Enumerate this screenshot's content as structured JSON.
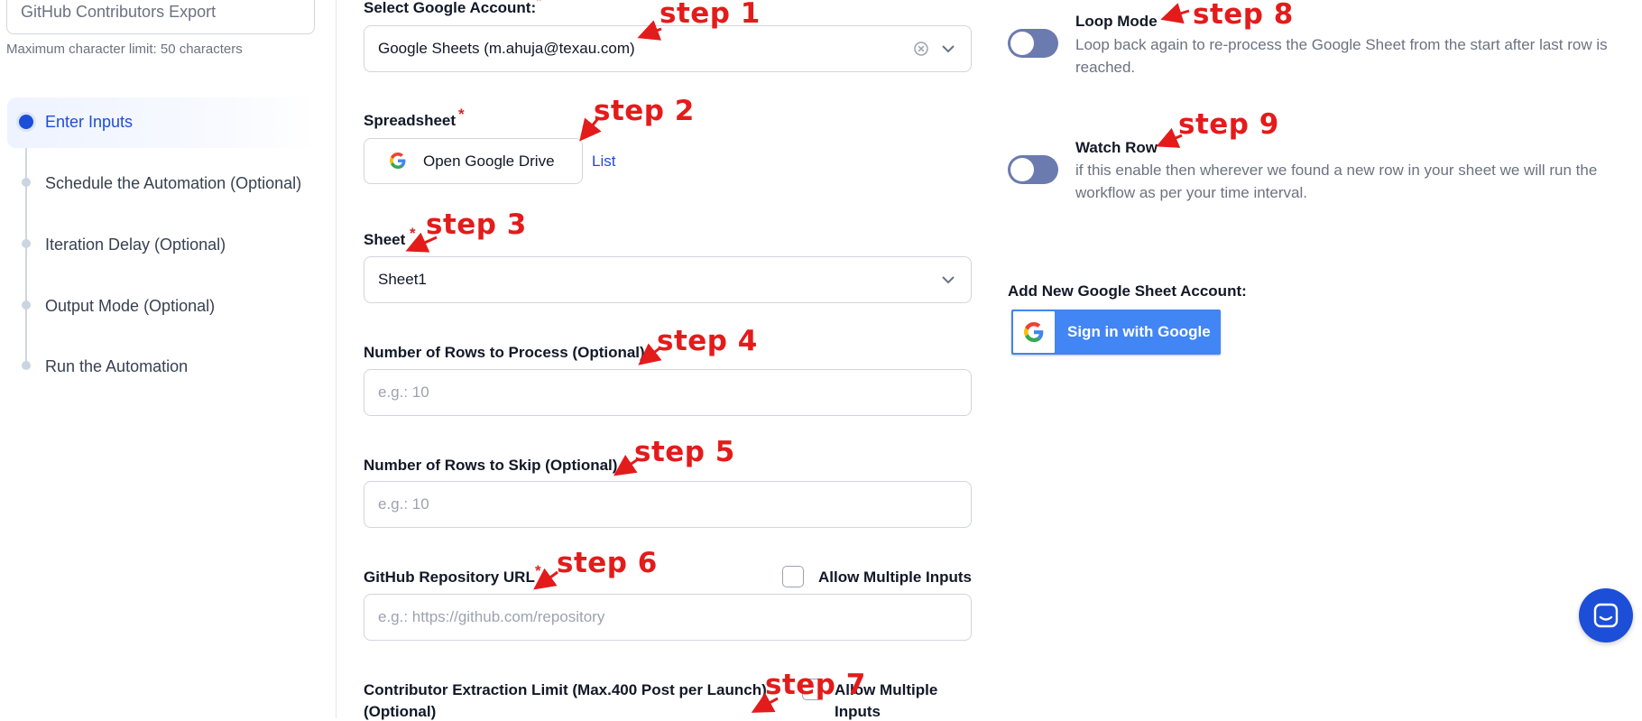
{
  "sidebar": {
    "automation_name": "GitHub Contributors Export",
    "char_limit_hint": "Maximum character limit: 50 characters",
    "steps": [
      {
        "label": "Enter Inputs",
        "active": true
      },
      {
        "label": "Schedule the Automation (Optional)",
        "active": false
      },
      {
        "label": "Iteration Delay (Optional)",
        "active": false
      },
      {
        "label": "Output Mode (Optional)",
        "active": false
      },
      {
        "label": "Run the Automation",
        "active": false
      }
    ]
  },
  "form": {
    "google_account": {
      "label": "Select Google Account:",
      "value": "Google Sheets (m.ahuja@texau.com)"
    },
    "spreadsheet": {
      "label": "Spreadsheet",
      "button_label": "Open Google Drive",
      "link_label": "List"
    },
    "sheet": {
      "label": "Sheet",
      "value": "Sheet1"
    },
    "rows_to_process": {
      "label": "Number of Rows to Process (Optional)",
      "placeholder": "e.g.: 10"
    },
    "rows_to_skip": {
      "label": "Number of Rows to Skip (Optional)",
      "placeholder": "e.g.: 10"
    },
    "repo_url": {
      "label": "GitHub Repository URL",
      "placeholder": "e.g.: https://github.com/repository",
      "multi_label": "Allow Multiple Inputs"
    },
    "contributor_limit": {
      "label_line1": "Contributor Extraction Limit (Max.400 Post per Launch)",
      "label_line2": "(Optional)",
      "multi_line1": "Allow Multiple",
      "multi_line2": "Inputs"
    }
  },
  "right": {
    "loop_mode": {
      "title": "Loop Mode",
      "desc": "Loop back again to re-process the Google Sheet from the start after last row is reached."
    },
    "watch_row": {
      "title": "Watch Row",
      "desc": "if this enable then wherever we found a new row in your sheet we will run the workflow as per your time interval."
    },
    "add_account_label": "Add New Google Sheet Account:",
    "google_signin_label": "Sign in with Google"
  },
  "annotations": {
    "step1": "step 1",
    "step2": "step 2",
    "step3": "step 3",
    "step4": "step 4",
    "step5": "step 5",
    "step6": "step 6",
    "step7": "step 7",
    "step8": "step 8",
    "step9": "step 9",
    "color": "#e41b1b"
  },
  "required_mark": "*",
  "colors": {
    "accent": "#1d4ed8",
    "toggle_off": "#6b7bb0",
    "google_blue": "#4285f4"
  },
  "icons": [
    "google-g-icon",
    "chevron-down-icon",
    "clear-icon",
    "chat-icon"
  ]
}
